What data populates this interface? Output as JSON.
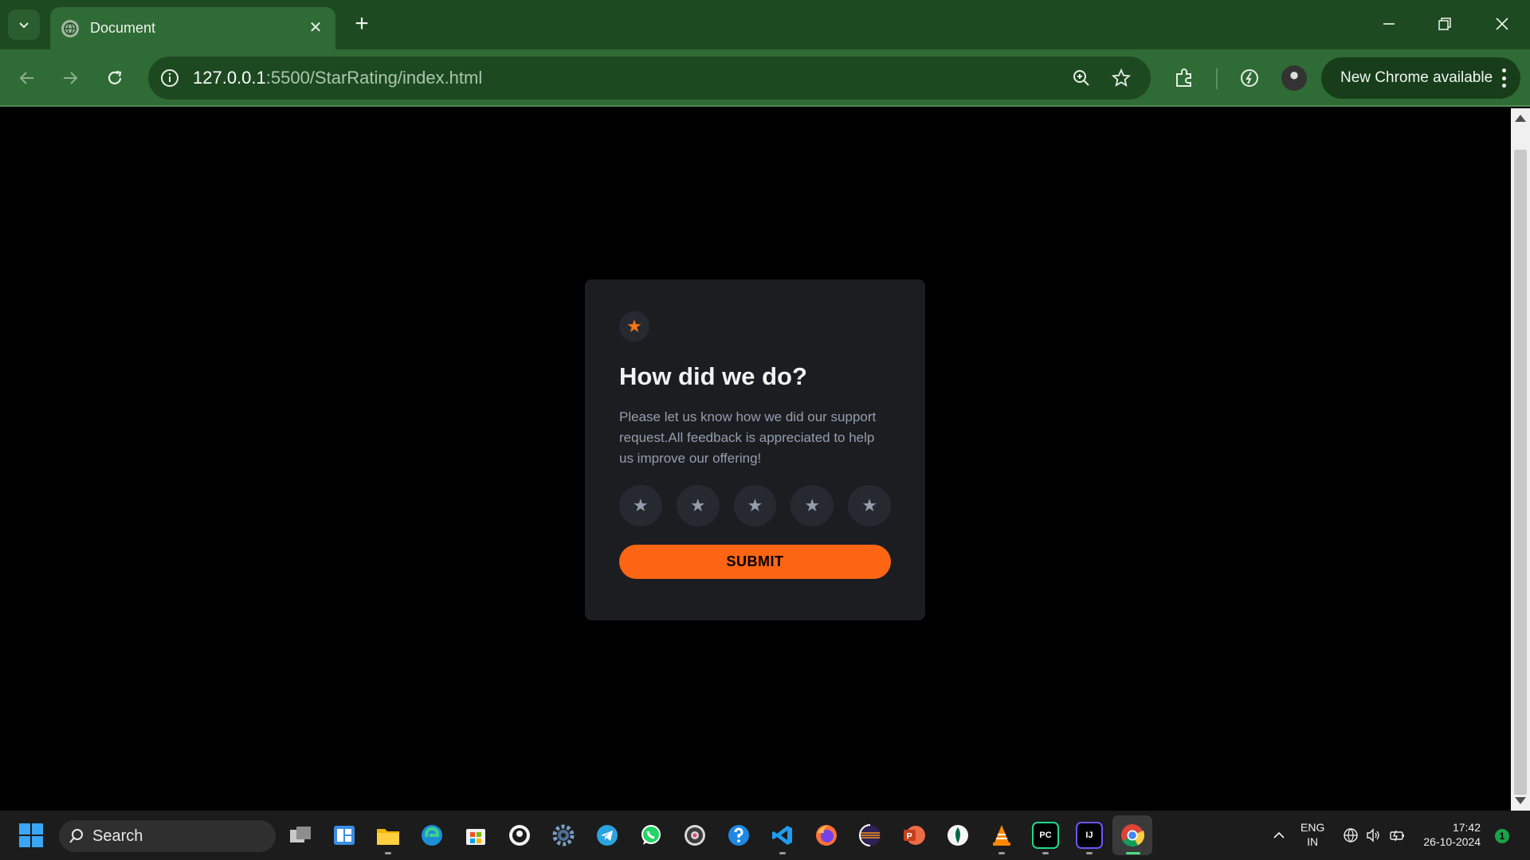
{
  "browser": {
    "tab_title": "Document",
    "url_host": "127.0.0.1",
    "url_rest": ":5500/StarRating/index.html",
    "update_label": "New Chrome available"
  },
  "card": {
    "icon": "★",
    "title": "How did we do?",
    "text": "Please let us know how we did our support request.All feedback is appreciated to help us improve our offering!",
    "ratings": [
      "★",
      "★",
      "★",
      "★",
      "★"
    ],
    "submit_label": "SUBMIT"
  },
  "taskbar": {
    "search_label": "Search",
    "apps": [
      "task-view",
      "widgets",
      "file-explorer",
      "edge",
      "microsoft-store",
      "github-desktop",
      "settings",
      "telegram",
      "whatsapp",
      "obs",
      "help",
      "vscode",
      "firefox",
      "eclipse",
      "powerpoint",
      "mongodb-compass",
      "vlc",
      "pycharm",
      "intellij",
      "chrome"
    ],
    "pycharm_label": "PC",
    "intellij_label": "IJ",
    "language": "ENG",
    "region": "IN",
    "time": "17:42",
    "date": "26-10-2024",
    "notification_count": "1"
  },
  "colors": {
    "accent": "#fc6513",
    "card_bg": "#1b1d21",
    "chrome_green": "#2f6b34"
  }
}
